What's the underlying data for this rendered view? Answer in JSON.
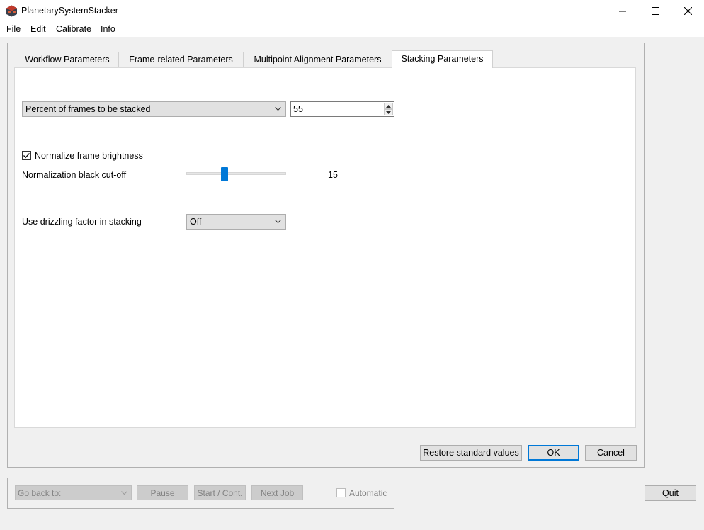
{
  "window": {
    "title": "PlanetarySystemStacker"
  },
  "menu": [
    "File",
    "Edit",
    "Calibrate",
    "Info"
  ],
  "tabs": [
    {
      "label": "Workflow Parameters",
      "active": false
    },
    {
      "label": "Frame-related Parameters",
      "active": false
    },
    {
      "label": "Multipoint Alignment Parameters",
      "active": false
    },
    {
      "label": "Stacking Parameters",
      "active": true
    }
  ],
  "stacking": {
    "frames_mode": "Percent of frames to be stacked",
    "frames_value": "55",
    "normalize_label": "Normalize frame brightness",
    "normalize_checked": true,
    "cutoff_label": "Normalization black cut-off",
    "cutoff_value": "15",
    "drizzle_label": "Use drizzling factor in stacking",
    "drizzle_value": "Off"
  },
  "dialog_buttons": {
    "restore": "Restore standard values",
    "ok": "OK",
    "cancel": "Cancel"
  },
  "controls": {
    "go_back_placeholder": "Go back to:",
    "pause": "Pause",
    "start": "Start / Cont.",
    "next_job": "Next Job",
    "automatic": "Automatic",
    "quit": "Quit"
  },
  "colors": {
    "accent": "#0078d7"
  }
}
